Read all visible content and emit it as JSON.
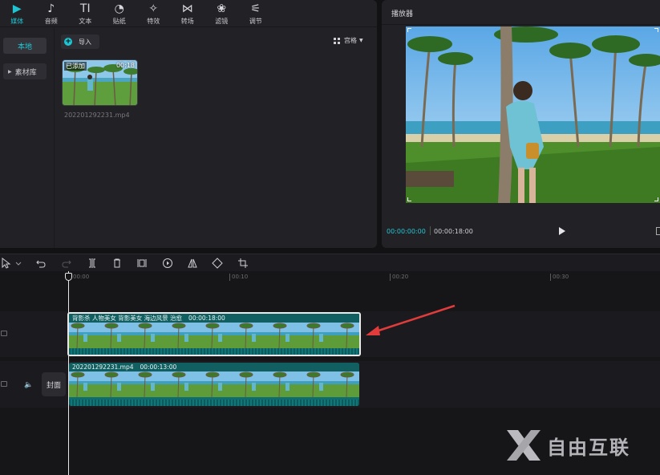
{
  "toolbar": {
    "tabs": [
      {
        "label": "媒体",
        "icon": "▶"
      },
      {
        "label": "音频",
        "icon": "♪"
      },
      {
        "label": "文本",
        "icon": "TI"
      },
      {
        "label": "贴纸",
        "icon": "◔"
      },
      {
        "label": "特效",
        "icon": "✧"
      },
      {
        "label": "转场",
        "icon": "⋈"
      },
      {
        "label": "滤镜",
        "icon": "❀"
      },
      {
        "label": "调节",
        "icon": "⚟"
      }
    ]
  },
  "left_nav": {
    "local": "本地",
    "library": "素材库"
  },
  "media": {
    "import_label": "导入",
    "view_label": "宫格",
    "clip": {
      "badge": "已添加",
      "duration": "00:18",
      "filename": "202201292231.mp4"
    }
  },
  "player": {
    "title": "播放器",
    "current_time": "00:00:00:00",
    "total_time": "00:00:18:00"
  },
  "timeline": {
    "ticks": [
      "00:00",
      "00:10",
      "00:20",
      "00:30"
    ],
    "cover_label": "封面",
    "clip1": {
      "title": "背影杀 人物美女 背影美女 海边风景 治愈",
      "duration": "00:00:18:00"
    },
    "clip2": {
      "title": "202201292231.mp4",
      "duration": "00:00:13:00"
    }
  },
  "watermark": {
    "text": "自由互联"
  },
  "colors": {
    "accent": "#20c3d0",
    "clip": "#0f6d6f",
    "arrow": "#e23b3b"
  }
}
